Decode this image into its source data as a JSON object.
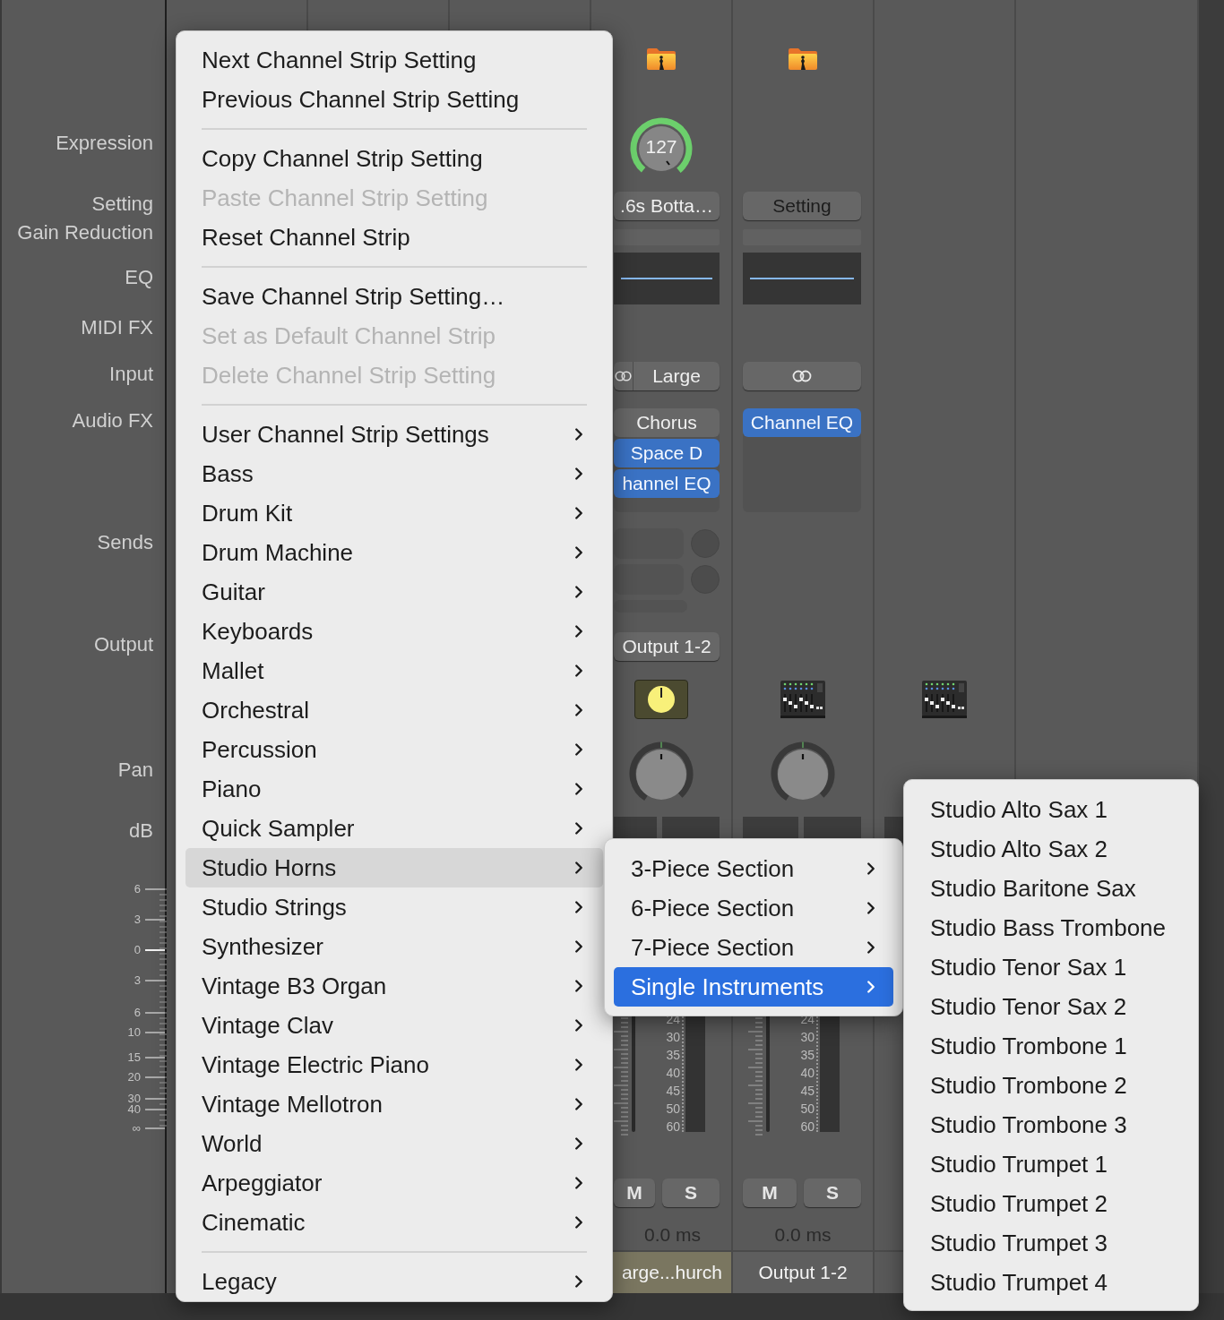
{
  "row_labels": [
    "Expression",
    "Setting",
    "Gain Reduction",
    "EQ",
    "MIDI FX",
    "Input",
    "Audio FX",
    "Sends",
    "Output",
    "Pan",
    "dB"
  ],
  "fader_scale": [
    "6",
    "3",
    "0",
    "3",
    "6",
    "10",
    "15",
    "20",
    "30",
    "40",
    "∞"
  ],
  "strips": [
    {
      "kind": "track",
      "expression": "127",
      "setting": ".6s Botta…",
      "input": {
        "linked": true,
        "label": "Large"
      },
      "audio_fx": [
        {
          "label": "Chorus",
          "on": false
        },
        {
          "label": "Space D",
          "on": true
        },
        {
          "label": "hannel EQ",
          "on": true
        }
      ],
      "has_sends": true,
      "output": "Output 1-2",
      "group_icon": {
        "kind": "knob"
      },
      "meter_scale": [
        "24",
        "30",
        "35",
        "40",
        "45",
        "50",
        "60"
      ],
      "mute": "M",
      "solo": "S",
      "delay": "0.0 ms",
      "name": "arge...hurch",
      "color": "#7a7660"
    },
    {
      "kind": "track",
      "setting": "Setting",
      "input": {
        "linked": true
      },
      "audio_fx": [
        {
          "label": "Channel EQ",
          "on": true
        }
      ],
      "has_sends": false,
      "group_icon": {
        "kind": "mixer"
      },
      "meter_scale": [
        "24",
        "30",
        "35",
        "40",
        "45",
        "50",
        "60"
      ],
      "mute": "M",
      "solo": "S",
      "delay": "0.0 ms",
      "name": "Output 1-2",
      "color": "#5e5e5e"
    },
    {
      "kind": "aux",
      "group_icon": {
        "kind": "mixer"
      }
    }
  ],
  "context_menu": {
    "items": [
      {
        "kind": "item",
        "label": "Next Channel Strip Setting",
        "disabled": false,
        "submenu": false,
        "selected": false
      },
      {
        "kind": "item",
        "label": "Previous Channel Strip Setting",
        "disabled": false,
        "submenu": false,
        "selected": false
      },
      {
        "kind": "separator"
      },
      {
        "kind": "item",
        "label": "Copy Channel Strip Setting",
        "disabled": false,
        "submenu": false,
        "selected": false
      },
      {
        "kind": "item",
        "label": "Paste Channel Strip Setting",
        "disabled": true,
        "submenu": false,
        "selected": false
      },
      {
        "kind": "item",
        "label": "Reset Channel Strip",
        "disabled": false,
        "submenu": false,
        "selected": false
      },
      {
        "kind": "separator"
      },
      {
        "kind": "item",
        "label": "Save Channel Strip Setting…",
        "disabled": false,
        "submenu": false,
        "selected": false
      },
      {
        "kind": "item",
        "label": "Set as Default Channel Strip",
        "disabled": true,
        "submenu": false,
        "selected": false
      },
      {
        "kind": "item",
        "label": "Delete Channel Strip Setting",
        "disabled": true,
        "submenu": false,
        "selected": false
      },
      {
        "kind": "separator"
      },
      {
        "kind": "item",
        "label": "User Channel Strip Settings",
        "disabled": false,
        "submenu": true,
        "selected": false
      },
      {
        "kind": "item",
        "label": "Bass",
        "disabled": false,
        "submenu": true,
        "selected": false
      },
      {
        "kind": "item",
        "label": "Drum Kit",
        "disabled": false,
        "submenu": true,
        "selected": false
      },
      {
        "kind": "item",
        "label": "Drum Machine",
        "disabled": false,
        "submenu": true,
        "selected": false
      },
      {
        "kind": "item",
        "label": "Guitar",
        "disabled": false,
        "submenu": true,
        "selected": false
      },
      {
        "kind": "item",
        "label": "Keyboards",
        "disabled": false,
        "submenu": true,
        "selected": false
      },
      {
        "kind": "item",
        "label": "Mallet",
        "disabled": false,
        "submenu": true,
        "selected": false
      },
      {
        "kind": "item",
        "label": "Orchestral",
        "disabled": false,
        "submenu": true,
        "selected": false
      },
      {
        "kind": "item",
        "label": "Percussion",
        "disabled": false,
        "submenu": true,
        "selected": false
      },
      {
        "kind": "item",
        "label": "Piano",
        "disabled": false,
        "submenu": true,
        "selected": false
      },
      {
        "kind": "item",
        "label": "Quick Sampler",
        "disabled": false,
        "submenu": true,
        "selected": false
      },
      {
        "kind": "item",
        "label": "Studio Horns",
        "disabled": false,
        "submenu": true,
        "selected": true
      },
      {
        "kind": "item",
        "label": "Studio Strings",
        "disabled": false,
        "submenu": true,
        "selected": false
      },
      {
        "kind": "item",
        "label": "Synthesizer",
        "disabled": false,
        "submenu": true,
        "selected": false
      },
      {
        "kind": "item",
        "label": "Vintage B3 Organ",
        "disabled": false,
        "submenu": true,
        "selected": false
      },
      {
        "kind": "item",
        "label": "Vintage Clav",
        "disabled": false,
        "submenu": true,
        "selected": false
      },
      {
        "kind": "item",
        "label": "Vintage Electric Piano",
        "disabled": false,
        "submenu": true,
        "selected": false
      },
      {
        "kind": "item",
        "label": "Vintage Mellotron",
        "disabled": false,
        "submenu": true,
        "selected": false
      },
      {
        "kind": "item",
        "label": "World",
        "disabled": false,
        "submenu": true,
        "selected": false
      },
      {
        "kind": "item",
        "label": "Arpeggiator",
        "disabled": false,
        "submenu": true,
        "selected": false
      },
      {
        "kind": "item",
        "label": "Cinematic",
        "disabled": false,
        "submenu": true,
        "selected": false
      },
      {
        "kind": "separator"
      },
      {
        "kind": "item",
        "label": "Legacy",
        "disabled": false,
        "submenu": true,
        "selected": false
      }
    ]
  },
  "horns_submenu": {
    "items": [
      {
        "kind": "item",
        "label": "3-Piece Section",
        "disabled": false,
        "submenu": true,
        "selected": false
      },
      {
        "kind": "item",
        "label": "6-Piece Section",
        "disabled": false,
        "submenu": true,
        "selected": false
      },
      {
        "kind": "item",
        "label": "7-Piece Section",
        "disabled": false,
        "submenu": true,
        "selected": false
      },
      {
        "kind": "item",
        "label": "Single Instruments",
        "disabled": false,
        "submenu": true,
        "selected": true
      }
    ]
  },
  "instruments_submenu": {
    "items": [
      {
        "kind": "item",
        "label": "Studio Alto Sax 1",
        "disabled": false,
        "submenu": false,
        "selected": false
      },
      {
        "kind": "item",
        "label": "Studio Alto Sax 2",
        "disabled": false,
        "submenu": false,
        "selected": false
      },
      {
        "kind": "item",
        "label": "Studio Baritone Sax",
        "disabled": false,
        "submenu": false,
        "selected": false
      },
      {
        "kind": "item",
        "label": "Studio Bass Trombone",
        "disabled": false,
        "submenu": false,
        "selected": false
      },
      {
        "kind": "item",
        "label": "Studio Tenor Sax 1",
        "disabled": false,
        "submenu": false,
        "selected": false
      },
      {
        "kind": "item",
        "label": "Studio Tenor Sax 2",
        "disabled": false,
        "submenu": false,
        "selected": false
      },
      {
        "kind": "item",
        "label": "Studio Trombone 1",
        "disabled": false,
        "submenu": false,
        "selected": false
      },
      {
        "kind": "item",
        "label": "Studio Trombone 2",
        "disabled": false,
        "submenu": false,
        "selected": false
      },
      {
        "kind": "item",
        "label": "Studio Trombone 3",
        "disabled": false,
        "submenu": false,
        "selected": false
      },
      {
        "kind": "item",
        "label": "Studio Trumpet 1",
        "disabled": false,
        "submenu": false,
        "selected": false
      },
      {
        "kind": "item",
        "label": "Studio Trumpet 2",
        "disabled": false,
        "submenu": false,
        "selected": false
      },
      {
        "kind": "item",
        "label": "Studio Trumpet 3",
        "disabled": false,
        "submenu": false,
        "selected": false
      },
      {
        "kind": "item",
        "label": "Studio Trumpet 4",
        "disabled": false,
        "submenu": false,
        "selected": false
      }
    ]
  }
}
